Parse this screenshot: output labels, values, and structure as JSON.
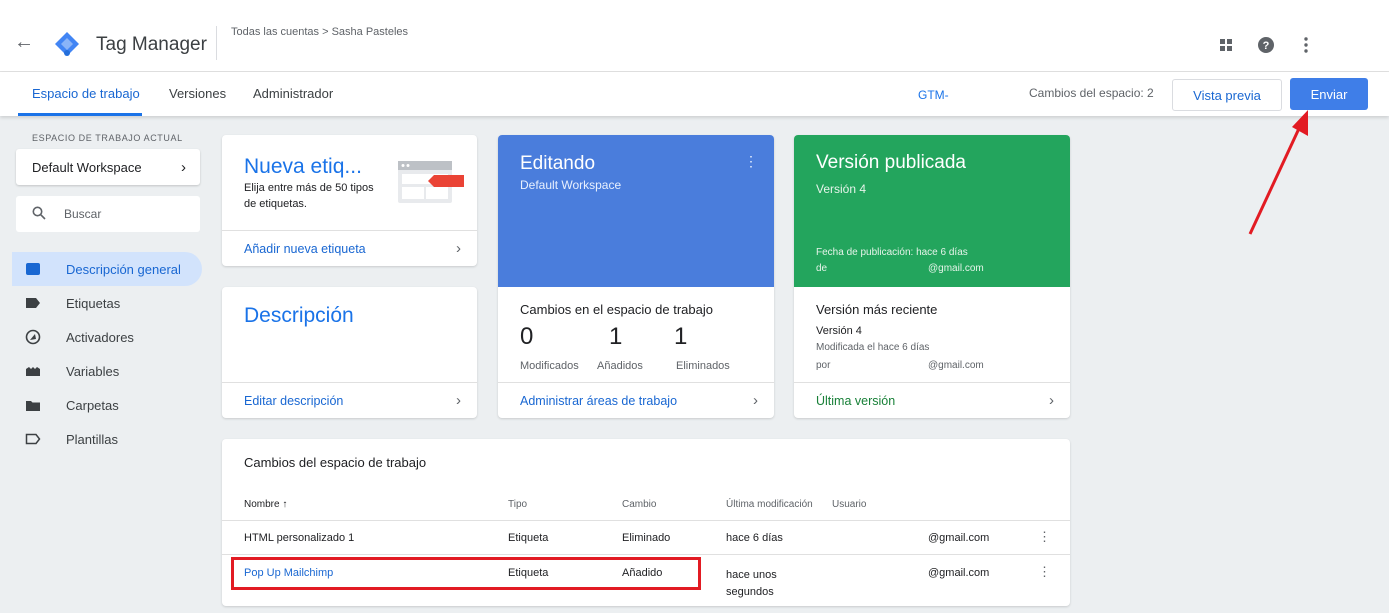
{
  "header": {
    "app_title": "Tag Manager",
    "breadcrumb": "Todas las cuentas > Sasha Pasteles",
    "icons": [
      "apps-icon",
      "help-icon",
      "more-vert-icon"
    ]
  },
  "nav": {
    "tabs": [
      {
        "label": "Espacio de trabajo",
        "active": true
      },
      {
        "label": "Versiones",
        "active": false
      },
      {
        "label": "Administrador",
        "active": false
      }
    ],
    "container_id": "GTM-",
    "changes_count": "Cambios del espacio: 2",
    "preview_label": "Vista previa",
    "submit_label": "Enviar"
  },
  "sidebar": {
    "workspace_label": "ESPACIO DE TRABAJO ACTUAL",
    "workspace_name": "Default Workspace",
    "search_placeholder": "Buscar",
    "items": [
      {
        "label": "Descripción general",
        "icon": "overview-icon",
        "active": true
      },
      {
        "label": "Etiquetas",
        "icon": "tag-icon",
        "active": false
      },
      {
        "label": "Activadores",
        "icon": "trigger-icon",
        "active": false
      },
      {
        "label": "Variables",
        "icon": "variables-icon",
        "active": false
      },
      {
        "label": "Carpetas",
        "icon": "folder-icon",
        "active": false
      },
      {
        "label": "Plantillas",
        "icon": "template-icon",
        "active": false
      }
    ]
  },
  "new_tag_card": {
    "title": "Nueva etiq...",
    "description": "Elija entre más de 50 tipos de etiquetas.",
    "footer": "Añadir nueva etiqueta"
  },
  "description_card": {
    "title": "Descripción",
    "footer": "Editar descripción"
  },
  "editing_card": {
    "title": "Editando",
    "subtitle": "Default Workspace",
    "changes_title": "Cambios en el espacio de trabajo",
    "stats": [
      {
        "value": "0",
        "label": "Modificados"
      },
      {
        "value": "1",
        "label": "Añadidos"
      },
      {
        "value": "1",
        "label": "Eliminados"
      }
    ],
    "footer": "Administrar áreas de trabajo"
  },
  "published_card": {
    "title": "Versión publicada",
    "subtitle": "Versión 4",
    "date": "Fecha de publicación: hace 6 días",
    "by": "de",
    "email": "@gmail.com",
    "latest_title": "Versión más reciente",
    "latest_version": "Versión 4",
    "latest_modified": "Modificada el hace 6 días",
    "latest_by": "por",
    "latest_email": "@gmail.com",
    "footer": "Última versión"
  },
  "changes_table": {
    "title": "Cambios del espacio de trabajo",
    "columns": [
      "Nombre ↑",
      "Tipo",
      "Cambio",
      "Última modificación",
      "Usuario"
    ],
    "rows": [
      {
        "name": "HTML personalizado 1",
        "type": "Etiqueta",
        "change": "Eliminado",
        "modified": "hace 6 días",
        "user": "@gmail.com"
      },
      {
        "name": "Pop Up Mailchimp",
        "type": "Etiqueta",
        "change": "Añadido",
        "modified": "hace unos segundos",
        "user": "@gmail.com"
      }
    ]
  },
  "colors": {
    "accent": "#1a73e8",
    "editing": "#4a7ddc",
    "published": "#23a55d",
    "annotation": "#e21b23"
  }
}
